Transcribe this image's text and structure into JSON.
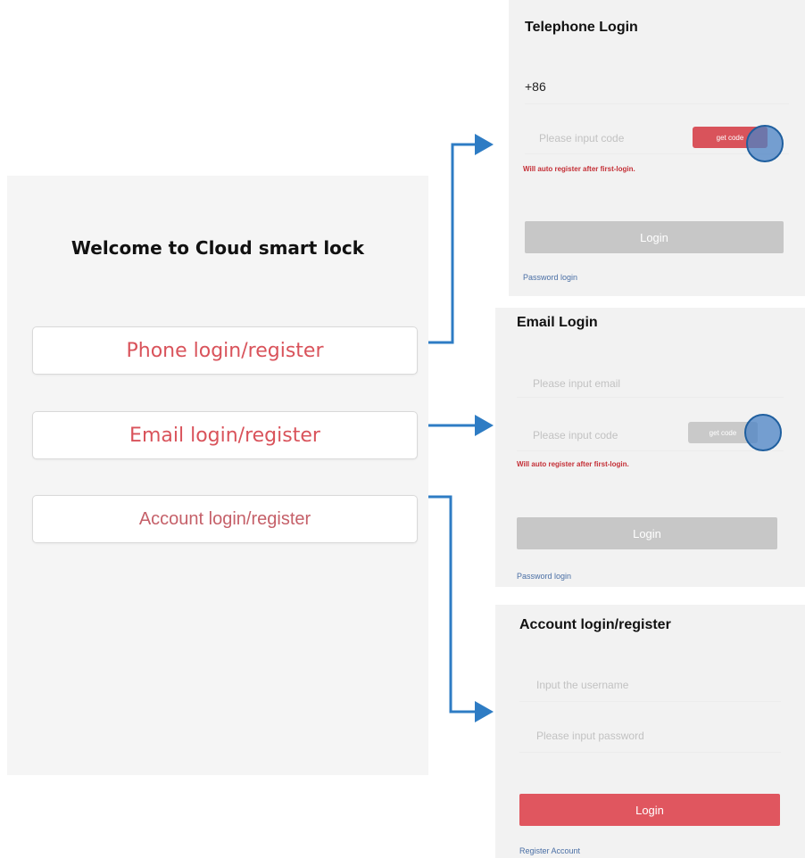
{
  "main": {
    "welcome": "Welcome to Cloud smart lock",
    "buttons": {
      "phone": "Phone login/register",
      "email": "Email login/register",
      "account": "Account login/register"
    }
  },
  "telephone": {
    "title": "Telephone Login",
    "country_code": "+86",
    "code_placeholder": "Please input code",
    "get_code": "get code",
    "hint": "Will auto register after first-login.",
    "login": "Login",
    "password_login": "Password login"
  },
  "email": {
    "title": "Email Login",
    "email_placeholder": "Please input email",
    "code_placeholder": "Please input code",
    "get_code": "get code",
    "hint": "Will auto register after first-login.",
    "login": "Login",
    "password_login": "Password login"
  },
  "account": {
    "title": "Account login/register",
    "username_placeholder": "Input the username",
    "password_placeholder": "Please input password",
    "login": "Login",
    "register": "Register Account"
  },
  "colors": {
    "accent": "#e0565f",
    "connector": "#2e7cc4",
    "disabled_button": "#c7c7c7"
  }
}
